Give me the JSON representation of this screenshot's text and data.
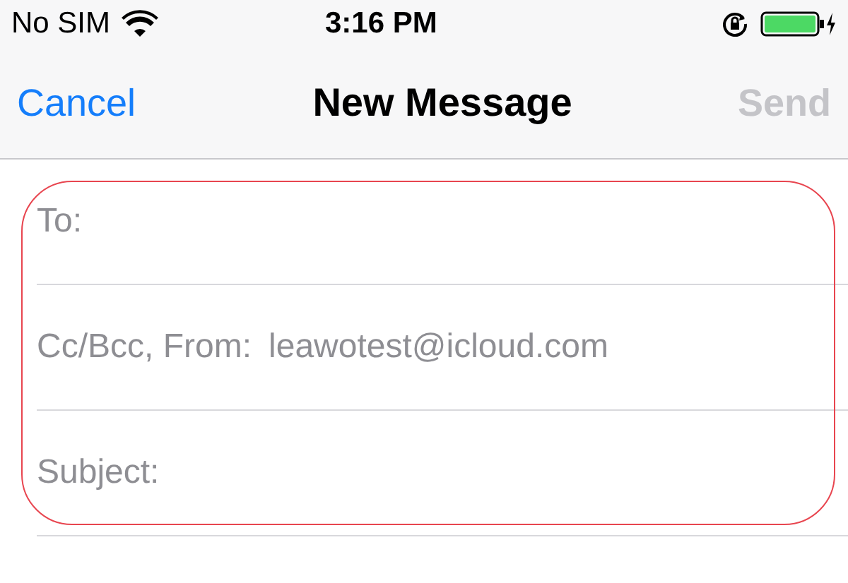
{
  "status_bar": {
    "carrier": "No SIM",
    "time": "3:16 PM"
  },
  "nav_bar": {
    "cancel": "Cancel",
    "title": "New Message",
    "send": {
      "label": "Send",
      "disabled": true
    }
  },
  "fields": [
    {
      "label": "To:"
    },
    {
      "label": "Cc/Bcc, From:",
      "value": "leawotest@icloud.com"
    },
    {
      "label": "Subject:"
    }
  ],
  "annotation": {
    "color": "#e8454f"
  }
}
